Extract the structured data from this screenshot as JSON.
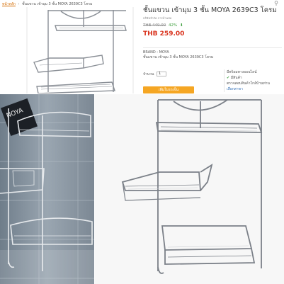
{
  "breadcrumb": {
    "home": "หน้าหลัก",
    "separator": "›",
    "current": "ชั้นแขวน เข้ามุม 3 ชั้น MOYA 2639C3 โครม"
  },
  "product": {
    "title": "ชั้นแขวน เข้ามุม 3 ชั้น MOYA 2639C3 โครม",
    "subtitle": "บริษัทจำกัด การบ้านข่อ",
    "old_price": "THB 449.00",
    "discount": "42%",
    "price": "THB 259.00",
    "brand_label": "BRAND : MOYA",
    "brand_desc": "ชั้นแขวน เข้ามุม 3 ชั้น MOYA 2639C3 โครม"
  },
  "purchase": {
    "qty_label": "จำนวน",
    "qty_value": "1",
    "buy_label": "เพิ่มในรถเข็น"
  },
  "store": {
    "availability": "มีพร้อมทางออนไลน์",
    "check_mark": "✔",
    "status": "มีสินค้า",
    "check_store": "ตรวจสอบสินค้าใกล้บ้านท่าน",
    "select_branch": "เลือกสาขา"
  },
  "photo_left": {
    "logo_text": "NOYA"
  },
  "colors": {
    "price": "#d9311b",
    "button": "#f5a623",
    "discount": "#3a9d3a",
    "link": "#2f6db5"
  }
}
